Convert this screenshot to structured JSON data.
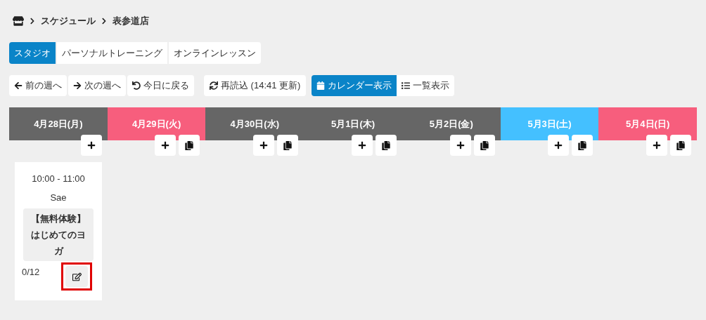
{
  "breadcrumb": [
    "スケジュール",
    "表参道店"
  ],
  "tabs": [
    {
      "label": "スタジオ",
      "selected": true
    },
    {
      "label": "パーソナルトレーニング",
      "selected": false
    },
    {
      "label": "オンラインレッスン",
      "selected": false
    }
  ],
  "toolbar": [
    {
      "kind": "prev",
      "label": "前の週へ"
    },
    {
      "kind": "next",
      "label": "次の週へ"
    },
    {
      "kind": "today",
      "label": "今日に戻る"
    }
  ],
  "reload": {
    "label": "再読込 (14:41 更新)"
  },
  "views": [
    {
      "kind": "calendar",
      "label": "カレンダー表示",
      "selected": true
    },
    {
      "kind": "list",
      "label": "一覧表示",
      "selected": false
    }
  ],
  "days": [
    {
      "label": "4月28日(月)",
      "color": "#666666",
      "copy_button": false,
      "events": [
        {
          "time": "10:00 - 11:00",
          "instructor": "Sae",
          "title": "【無料体験】はじめてのヨガ",
          "capacity": "0/12",
          "highlighted": true
        }
      ]
    },
    {
      "label": "4月29日(火)",
      "color": "#f75e7d",
      "copy_button": true
    },
    {
      "label": "4月30日(水)",
      "color": "#666666",
      "copy_button": true
    },
    {
      "label": "5月1日(木)",
      "color": "#666666",
      "copy_button": true
    },
    {
      "label": "5月2日(金)",
      "color": "#666666",
      "copy_button": true
    },
    {
      "label": "5月3日(土)",
      "color": "#44c0ff",
      "copy_button": true
    },
    {
      "label": "5月4日(日)",
      "color": "#f75e7d",
      "copy_button": true
    }
  ]
}
